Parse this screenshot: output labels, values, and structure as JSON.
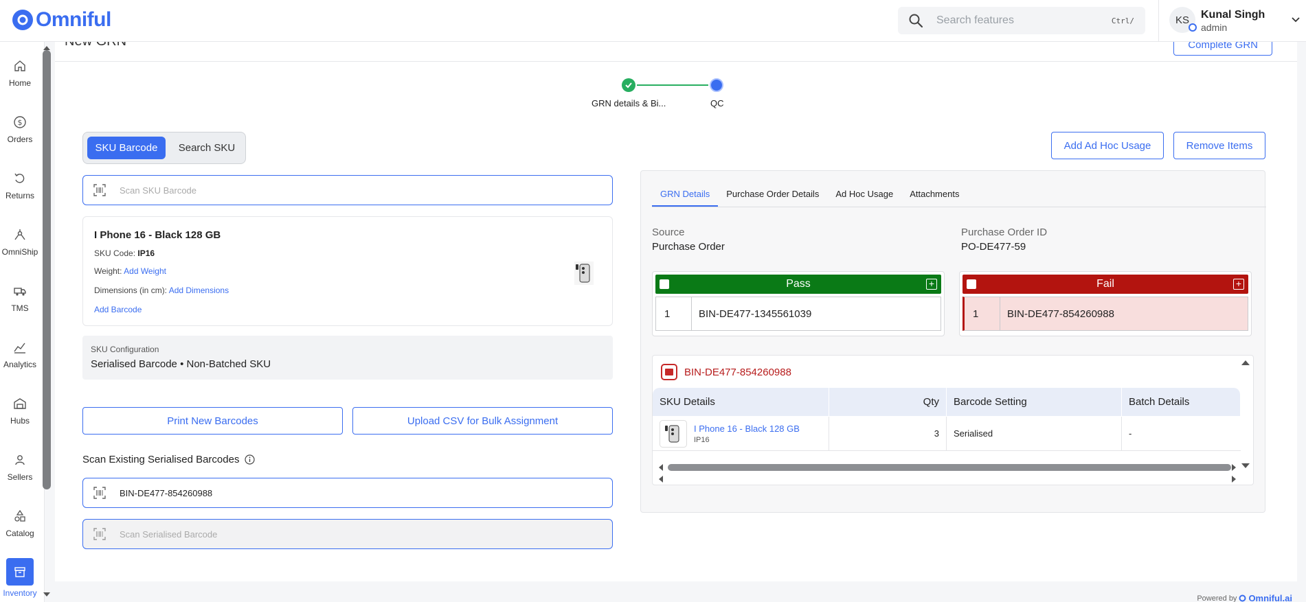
{
  "app": {
    "logo_text": "Omniful",
    "brand_color": "#3a6df0"
  },
  "header": {
    "search_placeholder": "Search features",
    "search_shortcut": "Ctrl/",
    "user_initials": "KS",
    "user_name": "Kunal Singh",
    "user_role": "admin"
  },
  "sidebar": {
    "items": [
      {
        "label": "Home",
        "icon": "home-icon"
      },
      {
        "label": "Orders",
        "icon": "dollar-icon"
      },
      {
        "label": "Returns",
        "icon": "return-icon"
      },
      {
        "label": "OmniShip",
        "icon": "network-icon"
      },
      {
        "label": "TMS",
        "icon": "truck-icon"
      },
      {
        "label": "Analytics",
        "icon": "chart-icon"
      },
      {
        "label": "Hubs",
        "icon": "warehouse-icon"
      },
      {
        "label": "Sellers",
        "icon": "user-icon"
      },
      {
        "label": "Catalog",
        "icon": "shapes-icon"
      },
      {
        "label": "Inventory",
        "icon": "box-icon",
        "active": true
      }
    ]
  },
  "page": {
    "title": "New GRN",
    "complete_button": "Complete GRN",
    "steps": [
      {
        "label": "GRN details & Bi...",
        "status": "done"
      },
      {
        "label": "QC",
        "status": "current"
      }
    ]
  },
  "left": {
    "toggle": {
      "active": "SKU Barcode",
      "inactive": "Search SKU"
    },
    "scan_sku_placeholder": "Scan SKU Barcode",
    "sku": {
      "name": "I Phone 16 - Black 128 GB",
      "code_label": "SKU Code:",
      "code": "IP16",
      "weight_label": "Weight:",
      "weight_link": "Add Weight",
      "dimensions_label": "Dimensions (in cm):",
      "dimensions_link": "Add Dimensions",
      "barcode_link": "Add Barcode"
    },
    "config": {
      "label": "SKU Configuration",
      "value": "Serialised Barcode  •  Non-Batched SKU"
    },
    "print_button": "Print New Barcodes",
    "upload_button": "Upload CSV for Bulk Assignment",
    "scan_existing_label": "Scan Existing Serialised Barcodes",
    "scan_existing_value": "BIN-DE477-854260988",
    "scan_serialised_placeholder": "Scan Serialised Barcode"
  },
  "right": {
    "add_adhoc_button": "Add Ad Hoc Usage",
    "remove_items_button": "Remove Items",
    "tabs": [
      "GRN Details",
      "Purchase Order Details",
      "Ad Hoc Usage",
      "Attachments"
    ],
    "active_tab": "GRN Details",
    "source_label": "Source",
    "source_value": "Purchase Order",
    "po_label": "Purchase Order ID",
    "po_value": "PO-DE477-59",
    "pass": {
      "title": "Pass",
      "color": "#0a7a16",
      "index": "1",
      "bin": "BIN-DE477-1345561039"
    },
    "fail": {
      "title": "Fail",
      "color": "#b3140f",
      "index": "1",
      "bin": "BIN-DE477-854260988"
    },
    "bin_detail": {
      "title": "BIN-DE477-854260988",
      "columns": [
        "SKU Details",
        "Qty",
        "Barcode Setting",
        "Batch Details"
      ],
      "rows": [
        {
          "name": "I Phone 16 - Black 128 GB",
          "code": "IP16",
          "qty": "3",
          "barcode_setting": "Serialised",
          "batch": "-"
        }
      ]
    }
  },
  "footer": {
    "powered_by": "Powered by",
    "brand": "Omniful.ai"
  }
}
